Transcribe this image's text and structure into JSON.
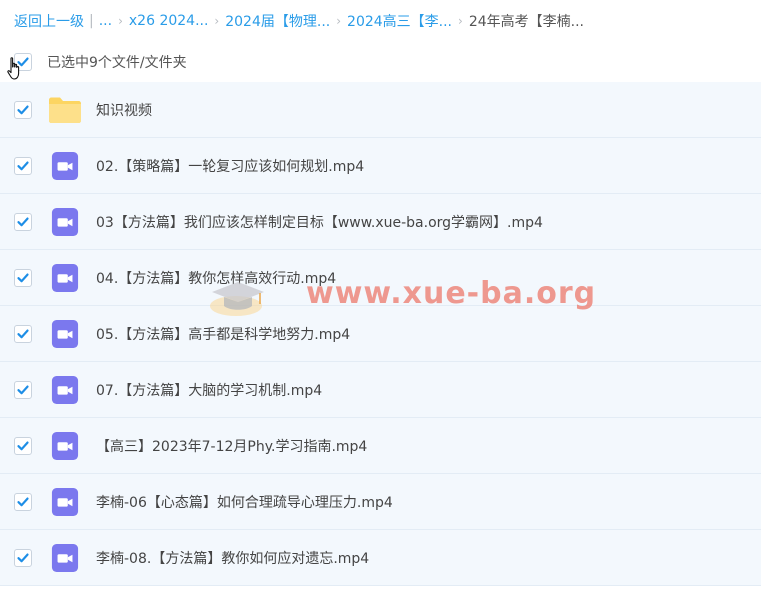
{
  "breadcrumb": {
    "back_label": "返回上一级",
    "separator": "|",
    "ellipsis": "...",
    "chevron": "›",
    "crumbs": [
      "x26 2024...",
      "2024届【物理...",
      "2024高三【李...",
      "24年高考【李楠..."
    ]
  },
  "selection": {
    "text": "已选中9个文件/文件夹"
  },
  "files": [
    {
      "name": "知识视频",
      "type": "folder"
    },
    {
      "name": "02.【策略篇】一轮复习应该如何规划.mp4",
      "type": "video"
    },
    {
      "name": "03【方法篇】我们应该怎样制定目标【www.xue-ba.org学霸网】.mp4",
      "type": "video"
    },
    {
      "name": "04.【方法篇】教你怎样高效行动.mp4",
      "type": "video"
    },
    {
      "name": "05.【方法篇】高手都是科学地努力.mp4",
      "type": "video"
    },
    {
      "name": "07.【方法篇】大脑的学习机制.mp4",
      "type": "video"
    },
    {
      "name": "【高三】2023年7-12月Phy.学习指南.mp4",
      "type": "video"
    },
    {
      "name": "李楠-06【心态篇】如何合理疏导心理压力.mp4",
      "type": "video"
    },
    {
      "name": "李楠-08.【方法篇】教你如何应对遗忘.mp4",
      "type": "video"
    }
  ],
  "watermark": {
    "text": "www.xue-ba.org"
  },
  "colors": {
    "link": "#2a9ce8",
    "checkbox_check": "#1e8ee6",
    "video_icon": "#7b78ee",
    "folder_icon": "#fcd562",
    "row_bg": "#f3f8fd"
  }
}
